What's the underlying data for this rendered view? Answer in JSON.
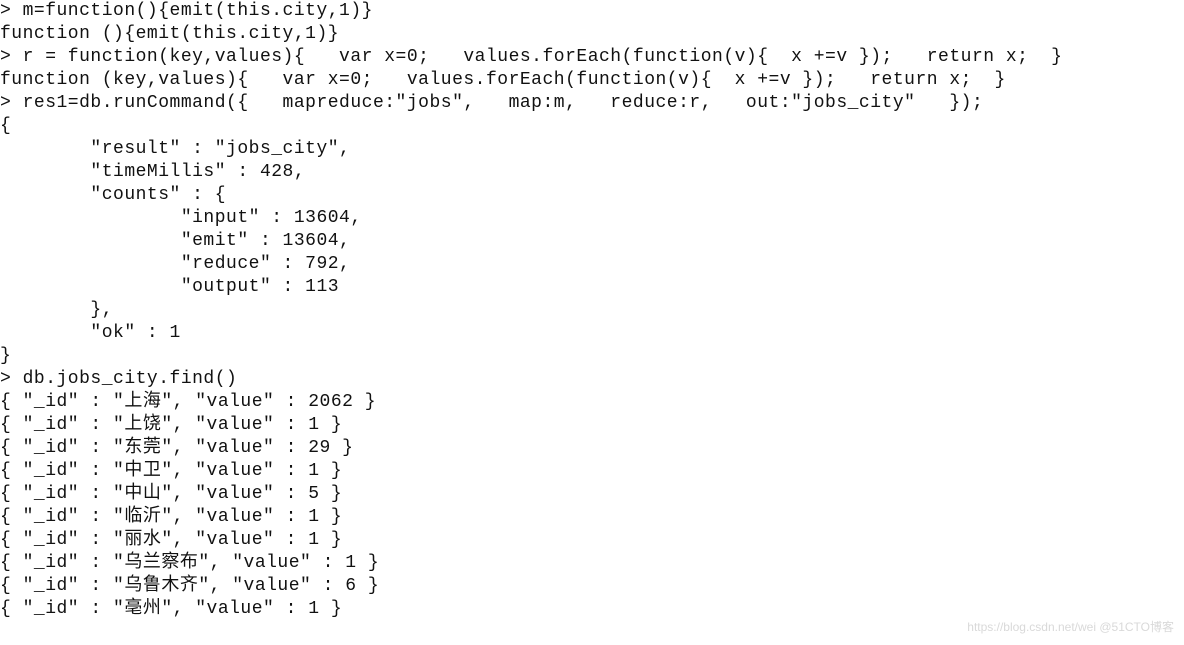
{
  "lines": [
    "> m=function(){emit(this.city,1)}",
    "function (){emit(this.city,1)}",
    "> r = function(key,values){   var x=0;   values.forEach(function(v){  x +=v });   return x;  }",
    "function (key,values){   var x=0;   values.forEach(function(v){  x +=v });   return x;  }",
    "> res1=db.runCommand({   mapreduce:\"jobs\",   map:m,   reduce:r,   out:\"jobs_city\"   });",
    "{",
    "        \"result\" : \"jobs_city\",",
    "        \"timeMillis\" : 428,",
    "        \"counts\" : {",
    "                \"input\" : 13604,",
    "                \"emit\" : 13604,",
    "                \"reduce\" : 792,",
    "                \"output\" : 113",
    "        },",
    "        \"ok\" : 1",
    "}",
    "> db.jobs_city.find()",
    "{ \"_id\" : \"上海\", \"value\" : 2062 }",
    "{ \"_id\" : \"上饶\", \"value\" : 1 }",
    "{ \"_id\" : \"东莞\", \"value\" : 29 }",
    "{ \"_id\" : \"中卫\", \"value\" : 1 }",
    "{ \"_id\" : \"中山\", \"value\" : 5 }",
    "{ \"_id\" : \"临沂\", \"value\" : 1 }",
    "{ \"_id\" : \"丽水\", \"value\" : 1 }",
    "{ \"_id\" : \"乌兰察布\", \"value\" : 1 }",
    "{ \"_id\" : \"乌鲁木齐\", \"value\" : 6 }",
    "{ \"_id\" : \"亳州\", \"value\" : 1 }"
  ],
  "watermark": "https://blog.csdn.net/wei @51CTO博客"
}
